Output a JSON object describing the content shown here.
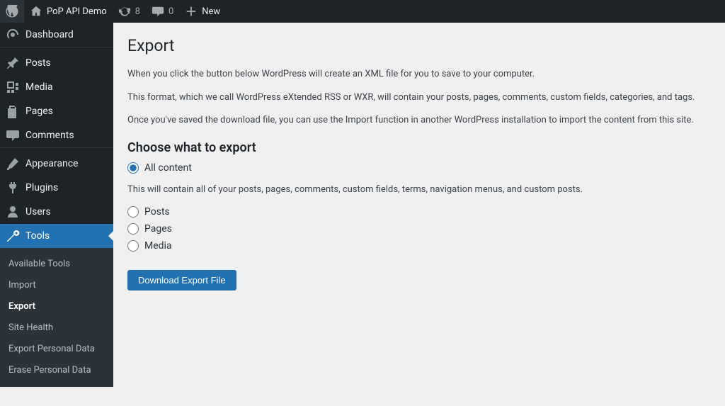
{
  "adminbar": {
    "site_name": "PoP API Demo",
    "updates_count": "8",
    "comments_count": "0",
    "new_label": "New"
  },
  "sidebar": {
    "items": [
      {
        "id": "dashboard",
        "label": "Dashboard"
      },
      {
        "id": "posts",
        "label": "Posts"
      },
      {
        "id": "media",
        "label": "Media"
      },
      {
        "id": "pages",
        "label": "Pages"
      },
      {
        "id": "comments",
        "label": "Comments"
      },
      {
        "id": "appearance",
        "label": "Appearance"
      },
      {
        "id": "plugins",
        "label": "Plugins"
      },
      {
        "id": "users",
        "label": "Users"
      },
      {
        "id": "tools",
        "label": "Tools"
      }
    ],
    "tools_submenu": [
      {
        "id": "available",
        "label": "Available Tools"
      },
      {
        "id": "import",
        "label": "Import"
      },
      {
        "id": "export",
        "label": "Export"
      },
      {
        "id": "site-health",
        "label": "Site Health"
      },
      {
        "id": "export-personal",
        "label": "Export Personal Data"
      },
      {
        "id": "erase-personal",
        "label": "Erase Personal Data"
      }
    ]
  },
  "page": {
    "title": "Export",
    "intro1": "When you click the button below WordPress will create an XML file for you to save to your computer.",
    "intro2": "This format, which we call WordPress eXtended RSS or WXR, will contain your posts, pages, comments, custom fields, categories, and tags.",
    "intro3": "Once you've saved the download file, you can use the Import function in another WordPress installation to import the content from this site.",
    "choose_heading": "Choose what to export",
    "options": {
      "all": {
        "label": "All content",
        "desc": "This will contain all of your posts, pages, comments, custom fields, terms, navigation menus, and custom posts."
      },
      "posts": {
        "label": "Posts"
      },
      "pages": {
        "label": "Pages"
      },
      "media": {
        "label": "Media"
      }
    },
    "selected": "all",
    "button": "Download Export File"
  }
}
